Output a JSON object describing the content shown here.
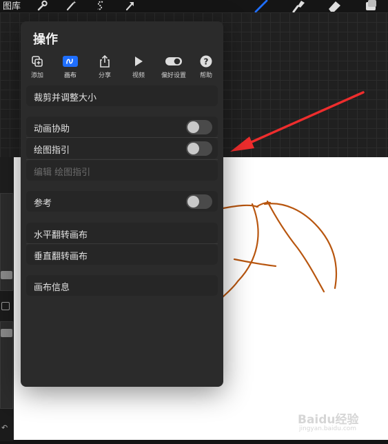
{
  "topbar": {
    "gallery_label": "图库",
    "left_tools": [
      "wrench-icon",
      "magic-wand-icon",
      "selection-s-icon",
      "transform-arrow-icon"
    ],
    "right_tools": [
      "brush-icon",
      "smudge-icon",
      "eraser-icon",
      "layers-icon"
    ],
    "accent": "#1f6fff"
  },
  "panel": {
    "title": "操作",
    "tabs": [
      {
        "label": "添加",
        "icon": "add-icon"
      },
      {
        "label": "画布",
        "icon": "canvas-icon",
        "active": true
      },
      {
        "label": "分享",
        "icon": "share-icon"
      },
      {
        "label": "视频",
        "icon": "play-icon"
      },
      {
        "label": "偏好设置",
        "icon": "toggle-icon"
      },
      {
        "label": "帮助",
        "icon": "help-icon"
      }
    ],
    "items": {
      "crop": "裁剪并调整大小",
      "animation_assist": "动画协助",
      "drawing_guide": "绘图指引",
      "edit_drawing_guide": "编辑 绘图指引",
      "reference": "参考",
      "flip_horizontal": "水平翻转画布",
      "flip_vertical": "垂直翻转画布",
      "canvas_info": "画布信息"
    },
    "toggles": {
      "animation_assist": false,
      "drawing_guide": false,
      "reference": false
    }
  },
  "colors": {
    "stroke": "#b8560f",
    "annotation_arrow": "#ee2d2d",
    "panel_bg": "#2b2b2b"
  },
  "watermark": {
    "text": "Baidu经验",
    "sub": "jingyan.baidu.com"
  }
}
